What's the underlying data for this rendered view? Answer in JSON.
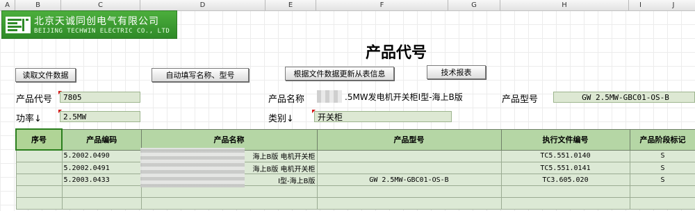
{
  "columns": [
    "A",
    "B",
    "C",
    "D",
    "E",
    "F",
    "G",
    "H",
    "I",
    "J"
  ],
  "logo": {
    "cn": "北京天诚同创电气有限公司",
    "en": "BEIJING TECHWIN ELECTRIC CO., LTD"
  },
  "title": "产品代号",
  "buttons": {
    "read_data": "读取文件数据",
    "auto_fill": "自动填写名称、型号",
    "update_from": "根据文件数据更新从表信息",
    "tech_report": "技术报表"
  },
  "fields": {
    "code_label": "产品代号",
    "code_value": "7805",
    "name_label": "产品名称",
    "name_value": ".5MW发电机开关柜I型-海上B版",
    "model_label": "产品型号",
    "model_value": "GW 2.5MW-GBC01-OS-B",
    "power_label": "功率↓",
    "power_value": "2.5MW",
    "category_label": "类别↓",
    "category_value": "开关柜"
  },
  "table": {
    "headers": [
      "序号",
      "产品编码",
      "产品名称",
      "产品型号",
      "执行文件编号",
      "产品阶段标记"
    ],
    "rows": [
      [
        "",
        "5.2002.0490",
        "海上B版 电机开关柜",
        "",
        "TC5.551.0140",
        "S"
      ],
      [
        "",
        "5.2002.0491",
        "海上B版 电机开关柜",
        "",
        "TC5.551.0141",
        "S"
      ],
      [
        "",
        "5.2003.0433",
        "I型-海上B版",
        "GW 2.5MW-GBC01-OS-B",
        "TC3.605.020",
        "S"
      ],
      [
        "",
        "",
        "",
        "",
        "",
        ""
      ],
      [
        "",
        "",
        "",
        "",
        "",
        ""
      ]
    ]
  },
  "colors": {
    "logo_green": "#3a9a30",
    "header_green": "#b5d6a5",
    "cell_green": "#dce9d5",
    "field_green": "#dde8d3",
    "marker_red": "#d61515"
  }
}
